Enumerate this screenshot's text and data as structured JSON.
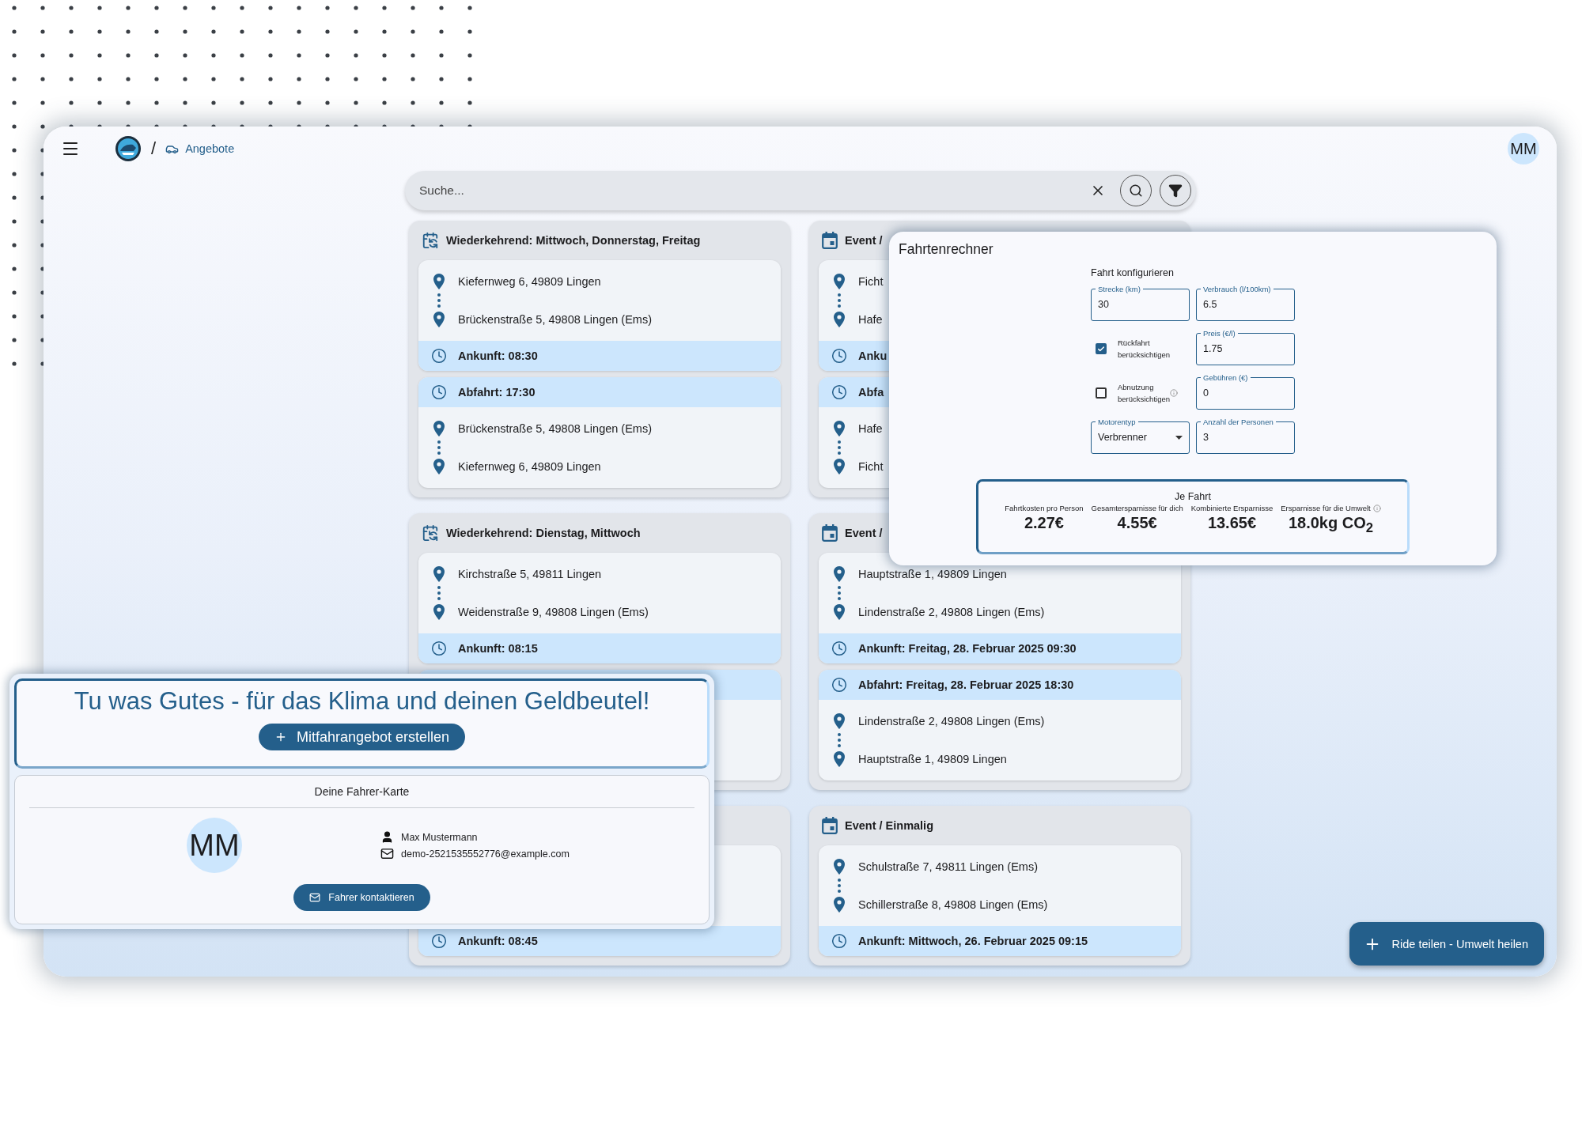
{
  "topbar": {
    "breadcrumb": {
      "separator": "/",
      "label": "Angebote"
    },
    "avatar": "MM"
  },
  "search": {
    "placeholder": "Suche..."
  },
  "columns": [
    [
      {
        "kind": "recurring",
        "title": "Wiederkehrend: Mittwoch, Donnerstag, Freitag",
        "legs": [
          {
            "kind": "outbound",
            "stops": [
              "Kiefernweg 6, 49809 Lingen",
              "Brückenstraße 5, 49808 Lingen (Ems)"
            ],
            "time": "Ankunft: 08:30"
          },
          {
            "kind": "return",
            "time": "Abfahrt: 17:30",
            "stops": [
              "Brückenstraße 5, 49808 Lingen (Ems)",
              "Kiefernweg 6, 49809 Lingen"
            ]
          }
        ]
      },
      {
        "kind": "recurring",
        "title": "Wiederkehrend: Dienstag, Mittwoch",
        "legs": [
          {
            "kind": "outbound",
            "stops": [
              "Kirchstraße 5, 49811 Lingen",
              "Weidenstraße 9, 49808 Lingen (Ems)"
            ],
            "time": "Ankunft: 08:15"
          },
          {
            "kind": "return"
          }
        ]
      },
      {
        "kind": "hidden",
        "legs": [
          {
            "kind": "outbound",
            "time": "Ankunft: 08:45"
          }
        ]
      }
    ],
    [
      {
        "kind": "event",
        "title": "Event /",
        "legs": [
          {
            "kind": "outbound",
            "stops": [
              "Ficht",
              "Hafe"
            ],
            "time": "Anku"
          },
          {
            "kind": "return",
            "time": "Abfa",
            "stops": [
              "Hafe",
              "Ficht"
            ]
          }
        ]
      },
      {
        "kind": "event",
        "title": "Event /",
        "legs": [
          {
            "kind": "outbound",
            "stops": [
              "Hauptstraße 1, 49809 Lingen",
              "Lindenstraße 2, 49808 Lingen (Ems)"
            ],
            "time": "Ankunft: Freitag, 28. Februar 2025 09:30"
          },
          {
            "kind": "return",
            "time": "Abfahrt: Freitag, 28. Februar 2025 18:30",
            "stops": [
              "Lindenstraße 2, 49808 Lingen (Ems)",
              "Hauptstraße 1, 49809 Lingen"
            ]
          }
        ]
      },
      {
        "kind": "event",
        "title": "Event / Einmalig",
        "legs": [
          {
            "kind": "outbound",
            "stops": [
              "Schulstraße 7, 49811 Lingen (Ems)",
              "Schillerstraße 8, 49808 Lingen (Ems)"
            ],
            "time": "Ankunft: Mittwoch, 26. Februar 2025 09:15"
          }
        ]
      }
    ]
  ],
  "calculator": {
    "title": "Fahrtenrechner",
    "subtitle": "Fahrt konfigurieren",
    "fields": [
      {
        "kind": "field",
        "label": "Strecke (km)",
        "value": "30"
      },
      {
        "kind": "field",
        "label": "Verbrauch (l/100km)",
        "value": "6.5"
      },
      {
        "kind": "checkbox",
        "label": "Rückfahrt berücksichtigen",
        "checked": true,
        "info": false
      },
      {
        "kind": "field",
        "label": "Preis (€/l)",
        "value": "1.75"
      },
      {
        "kind": "checkbox",
        "label": "Abnutzung berücksichtigen",
        "checked": false,
        "info": true
      },
      {
        "kind": "field",
        "label": "Gebühren (€)",
        "value": "0"
      },
      {
        "kind": "select",
        "label": "Motorentyp",
        "value": "Verbrenner"
      },
      {
        "kind": "field",
        "label": "Anzahl der Personen",
        "value": "3"
      }
    ],
    "results": {
      "title": "Je Fahrt",
      "items": [
        {
          "label": "Fahrtkosten pro Person",
          "value": "2.27€",
          "info": false
        },
        {
          "label": "Gesamtersparnisse für dich",
          "value": "4.55€",
          "info": false
        },
        {
          "label": "Kombinierte Ersparnisse",
          "value": "13.65€",
          "info": false
        },
        {
          "label": "Ersparnisse für die Umwelt",
          "value": "18.0kg CO$_{2}$",
          "info": true
        }
      ]
    }
  },
  "promo": {
    "heading": "Tu was Gutes - für das Klima und deinen Geldbeutel!",
    "button": "Mitfahrangebot erstellen"
  },
  "driver_card": {
    "title": "Deine Fahrer-Karte",
    "initials": "MM",
    "name": "Max Mustermann",
    "email": "demo-2521535552776@example.com",
    "button": "Fahrer kontaktieren"
  },
  "fab": {
    "label": "Ride teilen - Umwelt heilen"
  }
}
